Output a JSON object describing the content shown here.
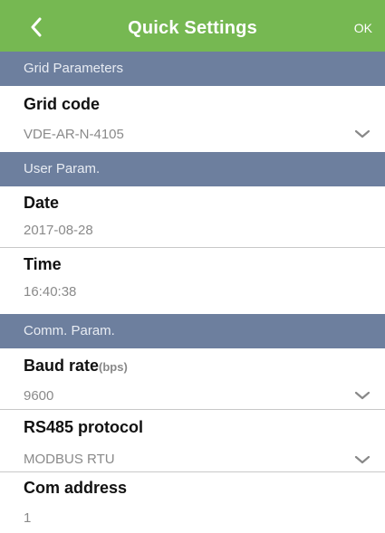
{
  "header": {
    "back_icon": "chevron-left-icon",
    "title": "Quick Settings",
    "ok_label": "OK",
    "color": "#76b852"
  },
  "sections": {
    "grid": {
      "title": "Grid Parameters",
      "grid_code": {
        "label": "Grid code",
        "value": "VDE-AR-N-4105",
        "icon": "chevron-down-icon"
      }
    },
    "user": {
      "title": "User Param.",
      "date": {
        "label": "Date",
        "value": "2017-08-28"
      },
      "time": {
        "label": "Time",
        "value": "16:40:38"
      }
    },
    "comm": {
      "title": "Comm. Param.",
      "baud_rate": {
        "label": "Baud rate",
        "unit": "(bps)",
        "value": "9600",
        "icon": "chevron-down-icon"
      },
      "rs485": {
        "label": "RS485 protocol",
        "value": "MODBUS RTU",
        "icon": "chevron-down-icon"
      },
      "com_address": {
        "label": "Com address",
        "value": "1"
      }
    }
  },
  "colors": {
    "section_header": "#6d7f9e",
    "label_text": "#111111",
    "value_text": "#8a8a8a"
  }
}
